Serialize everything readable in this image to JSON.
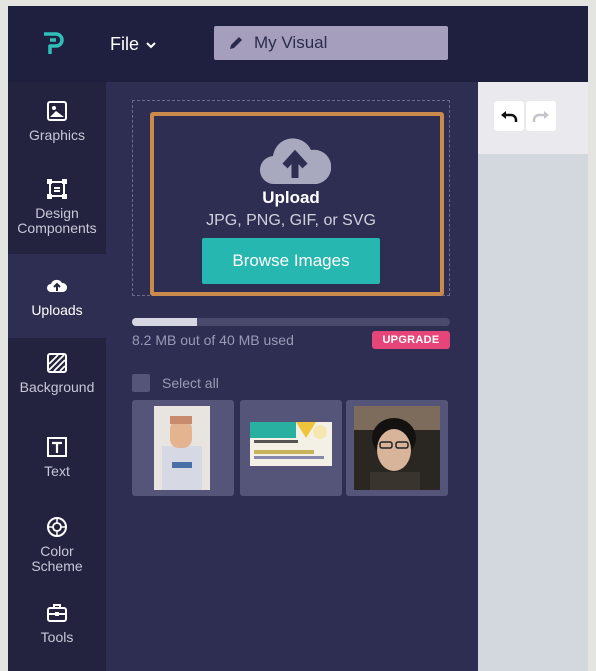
{
  "topbar": {
    "file_label": "File",
    "document_title": "My Visual"
  },
  "sidebar": {
    "items": [
      {
        "label": "Graphics",
        "icon": "image-icon"
      },
      {
        "label": "Design\nComponents",
        "icon": "components-icon"
      },
      {
        "label": "Uploads",
        "icon": "cloud-upload-icon",
        "active": true
      },
      {
        "label": "Background",
        "icon": "background-icon"
      },
      {
        "label": "Text",
        "icon": "text-icon"
      },
      {
        "label": "Color\nScheme",
        "icon": "palette-icon"
      },
      {
        "label": "Tools",
        "icon": "toolbox-icon"
      }
    ]
  },
  "upload": {
    "title": "Upload",
    "formats": "JPG, PNG, GIF, or SVG",
    "browse_label": "Browse Images",
    "usage_text": "8.2 MB out of 40 MB used",
    "usage_fraction": 0.205,
    "upgrade_label": "UPGRADE",
    "select_all_label": "Select all"
  },
  "colors": {
    "accent_teal": "#26b7b0",
    "upgrade_pink": "#e6457a",
    "highlight_orange": "#c98a4b"
  }
}
